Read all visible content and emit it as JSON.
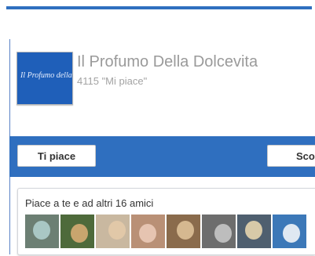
{
  "page": {
    "name": "Il Profumo Della Dolcevita",
    "likes": "4115 \"Mi piace\"",
    "thumbnail_text": "Il Profumo della"
  },
  "actions": {
    "like_label": "Ti piace",
    "share_label": "Sco"
  },
  "friends": {
    "text": "Piace a te e ad altri 16 amici",
    "avatars": [
      {
        "name": "friend-avatar-1",
        "bg": "#6c7f73",
        "accent": "#a9c7c4"
      },
      {
        "name": "friend-avatar-2",
        "bg": "#4e6a3b",
        "accent": "#c9a56e"
      },
      {
        "name": "friend-avatar-3",
        "bg": "#c9b8a0",
        "accent": "#e1c8a8"
      },
      {
        "name": "friend-avatar-4",
        "bg": "#b99076",
        "accent": "#e6c4b1"
      },
      {
        "name": "friend-avatar-5",
        "bg": "#8a6b4c",
        "accent": "#d5b890"
      },
      {
        "name": "friend-avatar-6",
        "bg": "#6d6d6d",
        "accent": "#bdbdbd"
      },
      {
        "name": "friend-avatar-7",
        "bg": "#4f5f6f",
        "accent": "#d7c9a8"
      },
      {
        "name": "friend-avatar-8",
        "bg": "#3c78b8",
        "accent": "#dfe8f2"
      }
    ]
  },
  "colors": {
    "brand_blue": "#2f6fbf"
  }
}
